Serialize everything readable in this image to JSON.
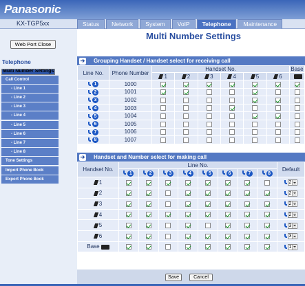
{
  "brand": "Panasonic",
  "model": "KX-TGP5xx",
  "tabs": [
    "Status",
    "Network",
    "System",
    "VoIP",
    "Telephone",
    "Maintenance"
  ],
  "active_tab": 4,
  "web_port_close": "Web Port Close",
  "sidebar": {
    "section": "Telephone",
    "items": [
      {
        "label": "Multi Number Settings",
        "sub": false,
        "selected": true
      },
      {
        "label": "Call Control",
        "sub": false
      },
      {
        "label": "- Line 1",
        "sub": true
      },
      {
        "label": "- Line 2",
        "sub": true
      },
      {
        "label": "- Line 3",
        "sub": true
      },
      {
        "label": "- Line 4",
        "sub": true
      },
      {
        "label": "- Line 5",
        "sub": true
      },
      {
        "label": "- Line 6",
        "sub": true
      },
      {
        "label": "- Line 7",
        "sub": true
      },
      {
        "label": "- Line 8",
        "sub": true
      },
      {
        "label": "Tone Settings",
        "sub": false
      },
      {
        "label": "Import Phone Book",
        "sub": false
      },
      {
        "label": "Export Phone Book",
        "sub": false
      }
    ]
  },
  "page_title": "Multi Number Settings",
  "receive": {
    "header": "Grouping Handset / Handset select for receiving call",
    "col_line": "Line No.",
    "col_phone": "Phone Number",
    "col_handset": "Handset No.",
    "col_base": "Base",
    "handsets": [
      "1",
      "2",
      "3",
      "4",
      "5",
      "6"
    ],
    "rows": [
      {
        "line": "1",
        "phone": "1000",
        "checks": [
          true,
          true,
          true,
          true,
          true,
          true
        ],
        "base": true
      },
      {
        "line": "2",
        "phone": "1001",
        "checks": [
          true,
          true,
          false,
          false,
          true,
          false
        ],
        "base": false
      },
      {
        "line": "3",
        "phone": "1002",
        "checks": [
          false,
          false,
          false,
          false,
          true,
          true
        ],
        "base": false
      },
      {
        "line": "4",
        "phone": "1003",
        "checks": [
          false,
          false,
          false,
          true,
          false,
          false
        ],
        "base": false
      },
      {
        "line": "5",
        "phone": "1004",
        "checks": [
          false,
          false,
          false,
          false,
          true,
          true
        ],
        "base": false
      },
      {
        "line": "6",
        "phone": "1005",
        "checks": [
          false,
          false,
          false,
          false,
          false,
          false
        ],
        "base": false
      },
      {
        "line": "7",
        "phone": "1006",
        "checks": [
          false,
          false,
          false,
          false,
          false,
          false
        ],
        "base": false
      },
      {
        "line": "8",
        "phone": "1007",
        "checks": [
          false,
          false,
          false,
          false,
          false,
          false
        ],
        "base": false
      }
    ]
  },
  "make": {
    "header": "Handset and Number select for making call",
    "col_handset": "Handset No.",
    "col_line": "Line No.",
    "col_default": "Default",
    "lines": [
      "1",
      "2",
      "3",
      "4",
      "5",
      "6",
      "7",
      "8"
    ],
    "rows": [
      {
        "handset": "1",
        "checks": [
          true,
          true,
          true,
          true,
          true,
          true,
          true,
          false
        ],
        "default": "2"
      },
      {
        "handset": "2",
        "checks": [
          true,
          true,
          false,
          true,
          true,
          true,
          true,
          true
        ],
        "default": "2"
      },
      {
        "handset": "3",
        "checks": [
          true,
          true,
          false,
          true,
          true,
          true,
          true,
          true
        ],
        "default": "2"
      },
      {
        "handset": "4",
        "checks": [
          true,
          true,
          true,
          true,
          true,
          true,
          true,
          true
        ],
        "default": "2"
      },
      {
        "handset": "5",
        "checks": [
          true,
          true,
          false,
          true,
          false,
          true,
          true,
          true
        ],
        "default": "3"
      },
      {
        "handset": "6",
        "checks": [
          true,
          true,
          false,
          true,
          true,
          true,
          true,
          true
        ],
        "default": "3"
      },
      {
        "handset": "Base",
        "checks": [
          true,
          true,
          false,
          true,
          true,
          true,
          true,
          true
        ],
        "default": "1"
      }
    ]
  },
  "buttons": {
    "save": "Save",
    "cancel": "Cancel"
  }
}
